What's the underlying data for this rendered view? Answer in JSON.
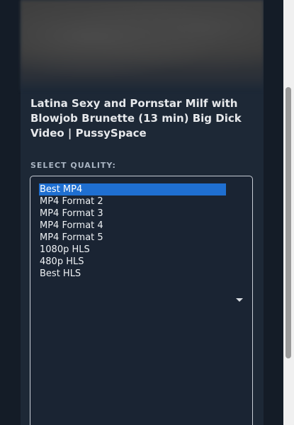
{
  "video": {
    "title": "Latina Sexy and Pornstar Milf with Blowjob Brunette (13 min) Big Dick Video | PussySpace"
  },
  "quality": {
    "label": "SELECT QUALITY:",
    "selected": "Best MP4",
    "options": [
      "Best MP4",
      "MP4 Format 2",
      "MP4 Format 3",
      "MP4 Format 4",
      "MP4 Format 5",
      "1080p HLS",
      "480p HLS",
      "Best HLS"
    ]
  },
  "colors": {
    "page_bg": "#131b26",
    "panel_bg": "#1d2836",
    "selected_bg": "#1f6fd1",
    "label_text": "#a9b4c2"
  },
  "icons": {
    "dropdown": "chevron-down-icon"
  }
}
